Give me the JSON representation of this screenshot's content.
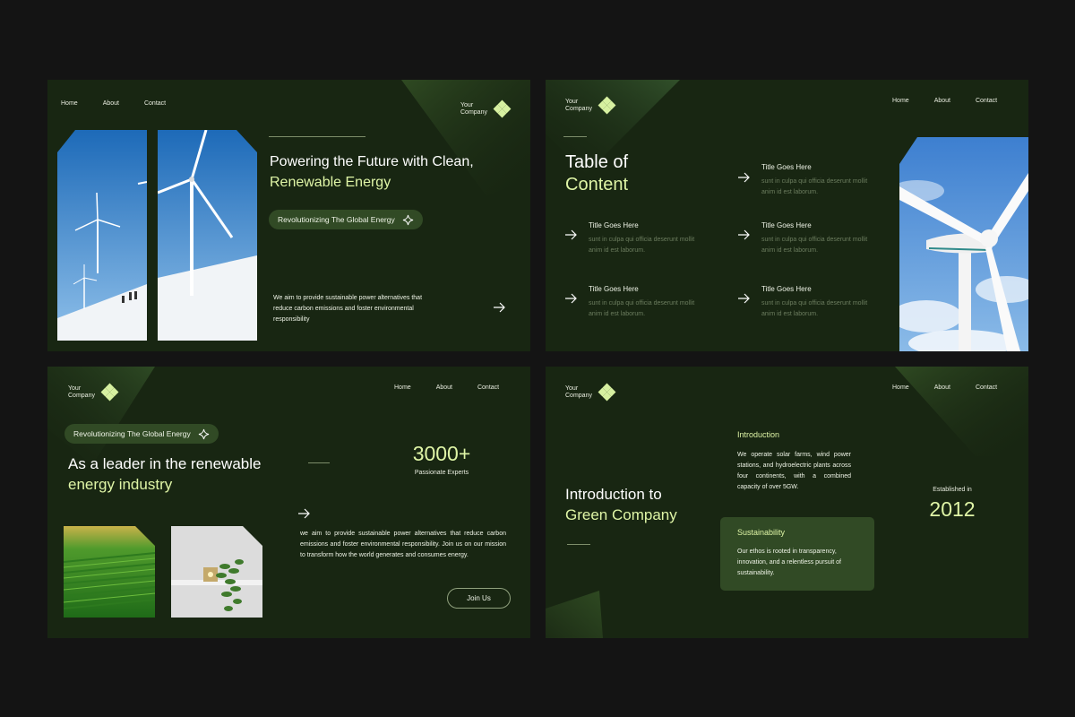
{
  "nav": {
    "home": "Home",
    "about": "About",
    "contact": "Contact"
  },
  "logo": {
    "line1": "Your",
    "line2": "Company"
  },
  "slide1": {
    "headline_1": "Powering the Future with Clean,",
    "headline_2": "Renewable Energy",
    "pill": "Revolutionizing The Global Energy",
    "body": "We aim to provide sustainable power alternatives that reduce carbon emissions and foster environmental responsibility"
  },
  "slide2": {
    "title_1": "Table of",
    "title_2": "Content",
    "items": [
      {
        "title": "Title Goes Here",
        "desc": "sunt in culpa qui officia deserunt mollit anim id est laborum."
      },
      {
        "title": "Title Goes Here",
        "desc": "sunt in culpa qui officia deserunt mollit anim id est laborum."
      },
      {
        "title": "Title Goes Here",
        "desc": "sunt in culpa qui officia deserunt mollit anim id est laborum."
      },
      {
        "title": "Title Goes Here",
        "desc": "sunt in culpa qui officia deserunt mollit anim id est laborum."
      },
      {
        "title": "Title Goes Here",
        "desc": "sunt in culpa qui officia deserunt mollit anim id est laborum."
      }
    ]
  },
  "slide3": {
    "pill": "Revolutionizing The Global Energy",
    "headline_1": "As a leader in the renewable",
    "headline_2": "energy industry",
    "stat_value": "3000+",
    "stat_label": "Passionate Experts",
    "body": "we aim to provide sustainable power alternatives that reduce carbon emissions and foster environmental responsibility. Join us on our mission to transform how the world generates and consumes energy.",
    "button": "Join Us"
  },
  "slide4": {
    "title_1": "Introduction to",
    "title_2": "Green Company",
    "intro_heading": "Introduction",
    "intro_body": "We operate solar farms, wind power stations, and hydroelectric plants across four continents, with a combined capacity of over 5GW.",
    "sus_heading": "Sustainability",
    "sus_body": "Our ethos is rooted in transparency, innovation, and a relentless pursuit of sustainability.",
    "est_label": "Established in",
    "est_year": "2012"
  },
  "colors": {
    "background": "#141414",
    "slide": "#182612",
    "accent": "#dff5a6",
    "pill": "#314a25"
  },
  "icons": [
    "logo-diamond-icon",
    "sparkle-icon",
    "arrow-right-icon"
  ]
}
